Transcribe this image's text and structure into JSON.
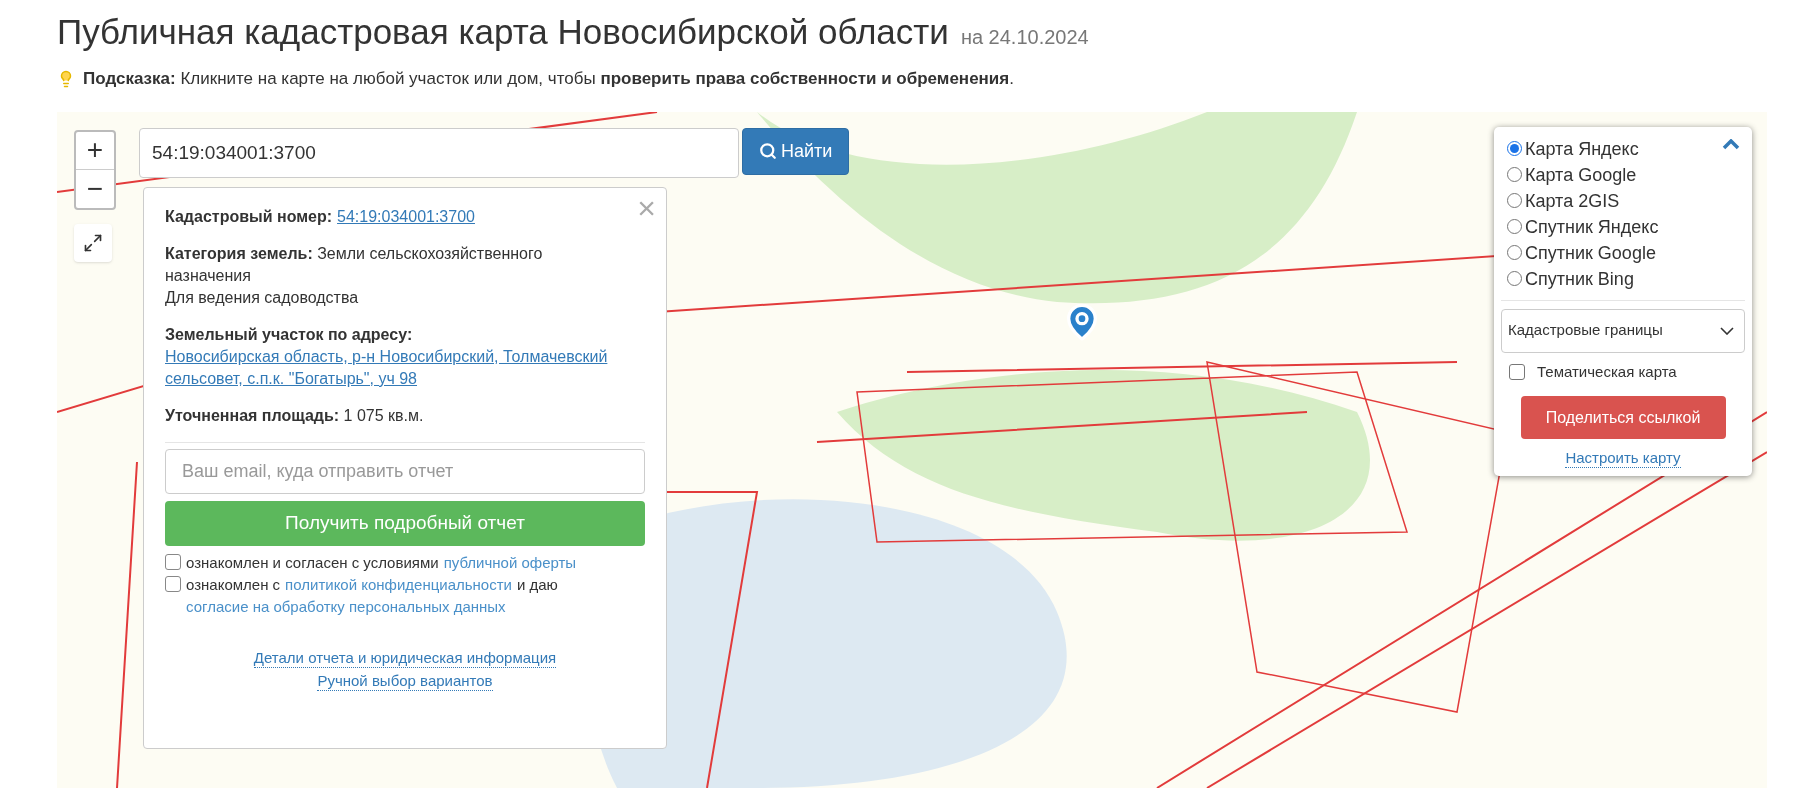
{
  "page": {
    "title": "Публичная кадастровая карта Новосибирской области",
    "date": "на 24.10.2024",
    "hint": "**Подсказка:** Кликните на карте на любой участок или дом, чтобы **проверить права собственности и обременения**."
  },
  "map_controls": {
    "zoom_in": "+",
    "zoom_out": "−"
  },
  "search": {
    "value": "54:19:034001:3700",
    "button": "Найти"
  },
  "popup": {
    "close": "×",
    "fields": [
      {
        "label": "Кадастровый номер:",
        "value": "54:19:034001:3700",
        "kind": "link"
      },
      {
        "label": "Категория земель:",
        "value": "Земли сельскохозяйственного назначения",
        "extra": "Для ведения садоводства",
        "kind": "text"
      },
      {
        "label": "Земельный участок по адресу:",
        "value": "Новосибирская область, р-н Новосибирский, Толмачевский сельсовет, с.п.к. \"Богатырь\", уч 98",
        "kind": "link"
      },
      {
        "label": "Уточненная площадь:",
        "value": "1 075 кв.м.",
        "kind": "text"
      }
    ],
    "email": {
      "placeholder": "Ваш email, куда отправить отчет"
    },
    "report_button": "Получить подробный отчет",
    "consents": [
      {
        "checked": false,
        "parts": [
          {
            "kind": "text",
            "text": "ознакомлен и согласен с условиями"
          },
          {
            "kind": "link",
            "text": "публичной оферты"
          }
        ]
      },
      {
        "checked": false,
        "parts": [
          {
            "kind": "text",
            "text": "ознакомлен с"
          },
          {
            "kind": "link",
            "text": "политикой конфиденциальности"
          },
          {
            "kind": "text",
            "text": "и даю"
          },
          {
            "kind": "link",
            "text": "согласие на обработку персональных данных"
          }
        ]
      }
    ],
    "links": [
      "Детали отчета и юридическая информация",
      "Ручной выбор вариантов"
    ]
  },
  "layers": {
    "options": [
      {
        "label": "Карта Яндекс",
        "selected": true
      },
      {
        "label": "Карта Google",
        "selected": false
      },
      {
        "label": "Карта 2GIS",
        "selected": false
      },
      {
        "label": "Спутник Яндекс",
        "selected": false
      },
      {
        "label": "Спутник Google",
        "selected": false
      },
      {
        "label": "Спутник Bing",
        "selected": false
      }
    ],
    "overlay_select": "Кадастровые границы",
    "thematic": {
      "label": "Тематическая карта",
      "checked": false
    },
    "share_button": "Поделиться ссылкой",
    "settings_link": "Настроить карту"
  }
}
